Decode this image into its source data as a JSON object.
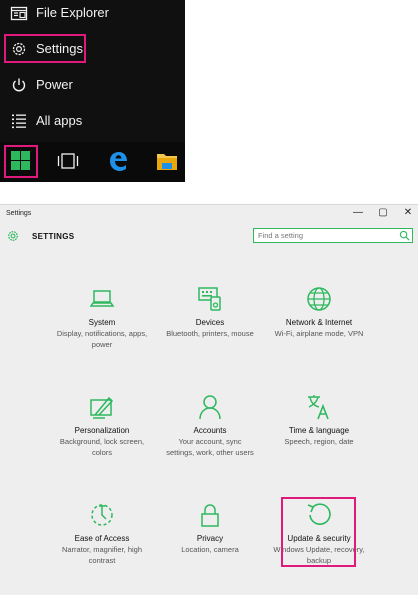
{
  "start_menu": {
    "items": [
      {
        "label": "File Explorer",
        "icon": "folder-icon"
      },
      {
        "label": "Settings",
        "icon": "gear-icon"
      },
      {
        "label": "Power",
        "icon": "power-icon"
      },
      {
        "label": "All apps",
        "icon": "list-icon"
      }
    ],
    "taskbar": [
      "windows-logo-icon",
      "task-view-icon",
      "edge-browser-icon",
      "file-explorer-icon"
    ]
  },
  "window": {
    "title": "Settings",
    "controls": {
      "minimize": "—",
      "maximize": "▢",
      "close": "✕"
    },
    "header": "SETTINGS",
    "search": {
      "placeholder": "Find a setting",
      "value": ""
    },
    "accent": "#2db85e",
    "highlight": "#e0197d"
  },
  "tiles": [
    {
      "name": "System",
      "desc": "Display, notifications, apps, power",
      "icon": "laptop-icon"
    },
    {
      "name": "Devices",
      "desc": "Bluetooth, printers, mouse",
      "icon": "devices-icon"
    },
    {
      "name": "Network & Internet",
      "desc": "Wi-Fi, airplane mode, VPN",
      "icon": "globe-icon"
    },
    {
      "name": "Personalization",
      "desc": "Background, lock screen, colors",
      "icon": "paint-icon"
    },
    {
      "name": "Accounts",
      "desc": "Your account, sync settings, work, other users",
      "icon": "person-icon"
    },
    {
      "name": "Time & language",
      "desc": "Speech, region, date",
      "icon": "time-language-icon"
    },
    {
      "name": "Ease of Access",
      "desc": "Narrator, magnifier, high contrast",
      "icon": "ease-of-access-icon"
    },
    {
      "name": "Privacy",
      "desc": "Location, camera",
      "icon": "lock-icon"
    },
    {
      "name": "Update & security",
      "desc": "Windows Update, recovery, backup",
      "icon": "refresh-icon"
    }
  ]
}
